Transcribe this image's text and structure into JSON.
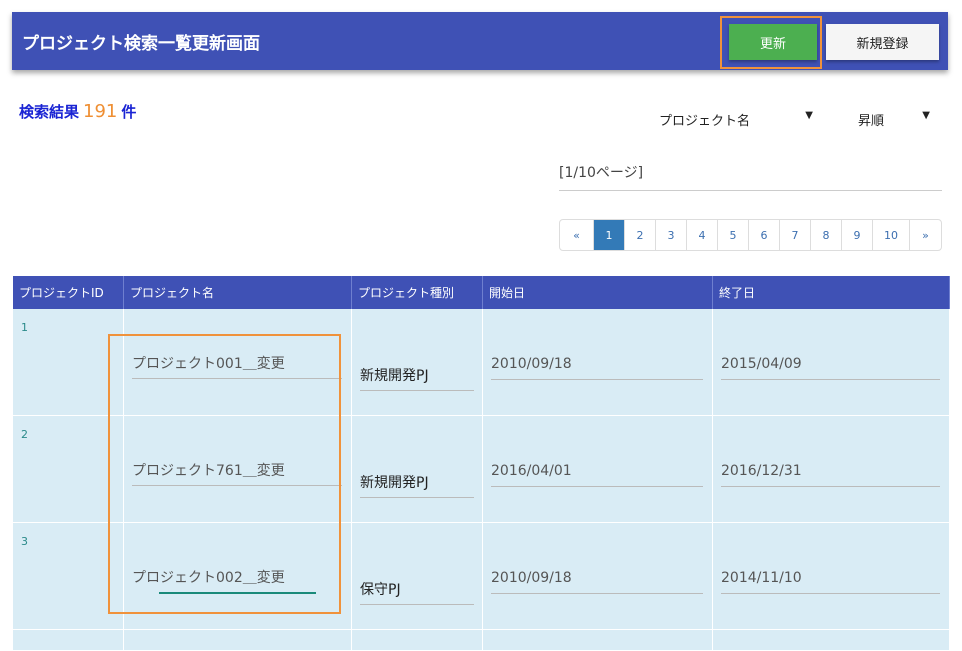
{
  "header": {
    "title": "プロジェクト検索一覧更新画面",
    "update_label": "更新",
    "new_label": "新規登録"
  },
  "result": {
    "prefix": "検索結果",
    "count": "191",
    "suffix": "件"
  },
  "sort": {
    "field": "プロジェクト名",
    "order": "昇順",
    "arrow": "▼"
  },
  "page_info": "[1/10ページ]",
  "pager": [
    "«",
    "1",
    "2",
    "3",
    "4",
    "5",
    "6",
    "7",
    "8",
    "9",
    "10",
    "»"
  ],
  "pager_active": "1",
  "table": {
    "headers": [
      "プロジェクトID",
      "プロジェクト名",
      "プロジェクト種別",
      "開始日",
      "終了日"
    ],
    "rows": [
      {
        "id": "1",
        "name": "プロジェクト001＿変更",
        "type": "新規開発PJ",
        "start": "2010/09/18",
        "end": "2015/04/09"
      },
      {
        "id": "2",
        "name": "プロジェクト761＿変更",
        "type": "新規開発PJ",
        "start": "2016/04/01",
        "end": "2016/12/31"
      },
      {
        "id": "3",
        "name": "プロジェクト002＿変更",
        "type": "保守PJ",
        "start": "2010/09/18",
        "end": "2014/11/10"
      }
    ]
  }
}
